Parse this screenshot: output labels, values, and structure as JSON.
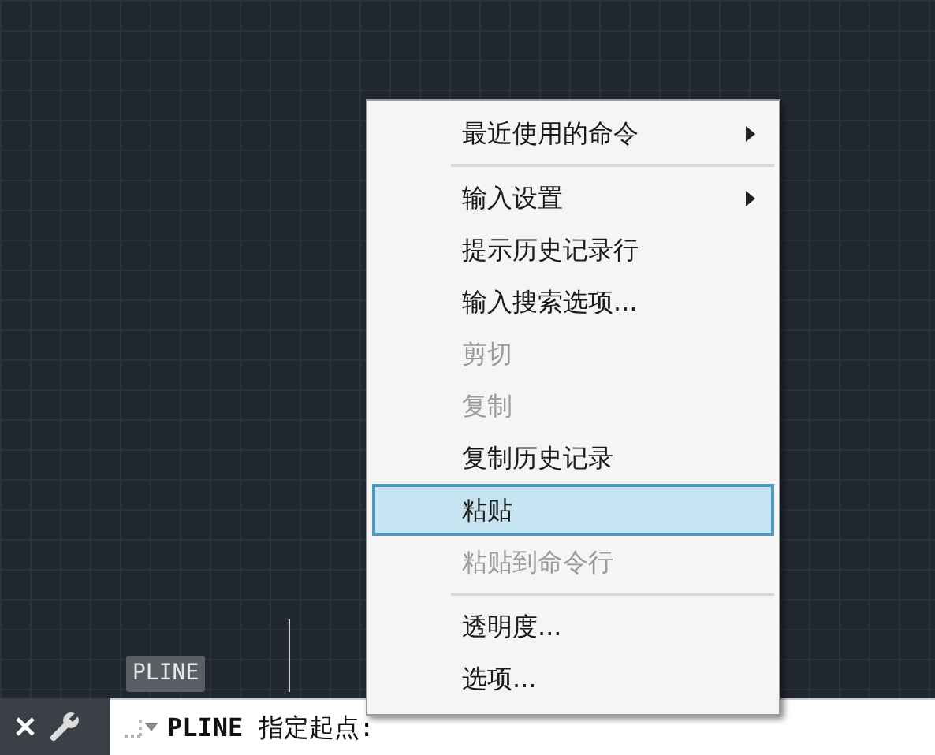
{
  "canvas": {
    "tooltip": "PLINE"
  },
  "context_menu": [
    {
      "kind": "item",
      "label": "最近使用的命令",
      "submenu": true,
      "disabled": false,
      "selected": false
    },
    {
      "kind": "separator"
    },
    {
      "kind": "item",
      "label": "输入设置",
      "submenu": true,
      "disabled": false,
      "selected": false
    },
    {
      "kind": "item",
      "label": "提示历史记录行",
      "submenu": false,
      "disabled": false,
      "selected": false
    },
    {
      "kind": "item",
      "label": "输入搜索选项...",
      "submenu": false,
      "disabled": false,
      "selected": false
    },
    {
      "kind": "item",
      "label": "剪切",
      "submenu": false,
      "disabled": true,
      "selected": false
    },
    {
      "kind": "item",
      "label": "复制",
      "submenu": false,
      "disabled": true,
      "selected": false
    },
    {
      "kind": "item",
      "label": "复制历史记录",
      "submenu": false,
      "disabled": false,
      "selected": false
    },
    {
      "kind": "item",
      "label": "粘贴",
      "submenu": false,
      "disabled": false,
      "selected": true
    },
    {
      "kind": "item",
      "label": "粘贴到命令行",
      "submenu": false,
      "disabled": true,
      "selected": false
    },
    {
      "kind": "separator"
    },
    {
      "kind": "item",
      "label": "透明度...",
      "submenu": false,
      "disabled": false,
      "selected": false
    },
    {
      "kind": "item",
      "label": "选项...",
      "submenu": false,
      "disabled": false,
      "selected": false
    }
  ],
  "command_line": {
    "prompt": "**PLINE** 指定起点:"
  }
}
